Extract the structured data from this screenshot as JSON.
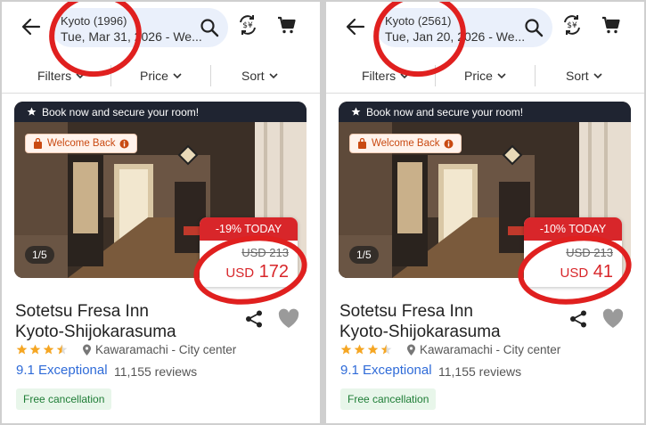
{
  "colors": {
    "accent_blue": "#2f6bd8",
    "deal_red": "#d8262a",
    "annotation_red": "#e0201f",
    "banner_dark": "#1f2431",
    "free_green": "#1e7d36"
  },
  "icons": [
    "back-arrow-icon",
    "search-icon",
    "currency-exchange-icon",
    "cart-icon",
    "chevron-down-icon",
    "star-icon",
    "bag-icon",
    "info-icon",
    "location-pin-icon",
    "share-icon",
    "heart-icon"
  ],
  "panels": [
    {
      "search": {
        "city": "Kyoto (1996)",
        "dates": "Tue, Mar 31, 2026 - We..."
      },
      "filters": {
        "filters": "Filters",
        "price": "Price",
        "sort": "Sort"
      },
      "banner": "Book now and secure your room!",
      "welcome": "Welcome Back",
      "photo_counter": "1/5",
      "deal": "-19% TODAY",
      "old_price": "USD 213",
      "currency": "USD",
      "price": "172",
      "hotel": {
        "name_line1": "Sotetsu Fresa Inn",
        "name_line2": "Kyoto-Shijokarasuma",
        "stars": 3.5
      },
      "location": "Kawaramachi - City center",
      "rating": "9.1 Exceptional",
      "reviews": "11,155 reviews",
      "free_cancellation": "Free cancellation"
    },
    {
      "search": {
        "city": "Kyoto (2561)",
        "dates": "Tue, Jan 20, 2026 - We..."
      },
      "filters": {
        "filters": "Filters",
        "price": "Price",
        "sort": "Sort"
      },
      "banner": "Book now and secure your room!",
      "welcome": "Welcome Back",
      "photo_counter": "1/5",
      "deal": "-10% TODAY",
      "old_price": "USD 213",
      "currency": "USD",
      "price": "41",
      "hotel": {
        "name_line1": "Sotetsu Fresa Inn",
        "name_line2": "Kyoto-Shijokarasuma",
        "stars": 3.5
      },
      "location": "Kawaramachi - City center",
      "rating": "9.1 Exceptional",
      "reviews": "11,155 reviews",
      "free_cancellation": "Free cancellation"
    }
  ]
}
